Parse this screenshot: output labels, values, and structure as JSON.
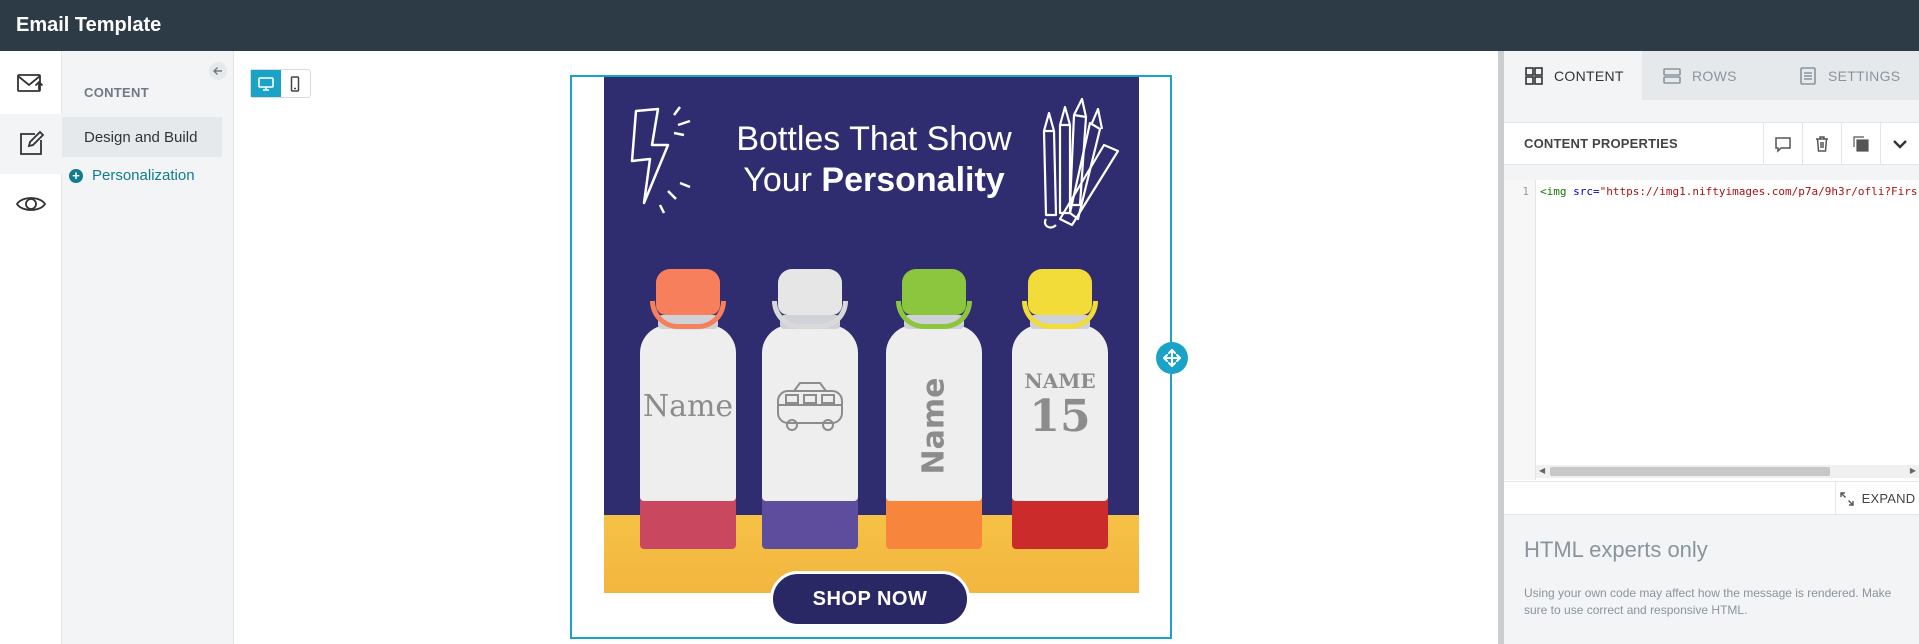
{
  "app": {
    "title": "Email Template"
  },
  "rail": {
    "items": [
      {
        "icon": "mail-send-icon",
        "active": false
      },
      {
        "icon": "edit-icon",
        "active": true
      },
      {
        "icon": "eye-icon",
        "active": false
      }
    ]
  },
  "left_panel": {
    "heading": "CONTENT",
    "active_item": "Design and Build",
    "link": "Personalization"
  },
  "device_toggle": {
    "selected": "desktop",
    "options": [
      "desktop",
      "mobile"
    ]
  },
  "canvas": {
    "headline_line1": "Bottles That Show",
    "headline_line2_prefix": "Your",
    "headline_line2_bold": "Personality",
    "bottles": [
      {
        "engraving": "Name",
        "color": "#f77f5c",
        "boot": "#c9475f"
      },
      {
        "engraving": "",
        "color": "#e6e6e6",
        "boot": "#5d4d9c"
      },
      {
        "engraving": "Name",
        "color": "#8cc63f",
        "boot": "#f7853c"
      },
      {
        "engraving": "NAME",
        "number": "15",
        "color": "#f2dc3a",
        "boot": "#cc2b2b"
      }
    ],
    "cta": "SHOP NOW"
  },
  "right_panel": {
    "tabs": [
      {
        "label": "CONTENT",
        "active": true
      },
      {
        "label": "ROWS",
        "active": false
      },
      {
        "label": "SETTINGS",
        "active": false
      }
    ],
    "properties_title": "CONTENT PROPERTIES",
    "code": {
      "line_number": "1",
      "tag": "<img",
      "attr": " src=",
      "value": "\"https://img1.niftyimages.com/p7a/9h3r/ofli?Firs"
    },
    "expand_label": "EXPAND",
    "experts_title": "HTML experts only",
    "experts_note": "Using your own code may affect how the message is rendered. Make sure to use correct and responsive HTML."
  },
  "colors": {
    "accent": "#1aa3c6",
    "topbar": "#2d3b47",
    "link": "#127c8c",
    "cta_bg": "#2a2765"
  }
}
